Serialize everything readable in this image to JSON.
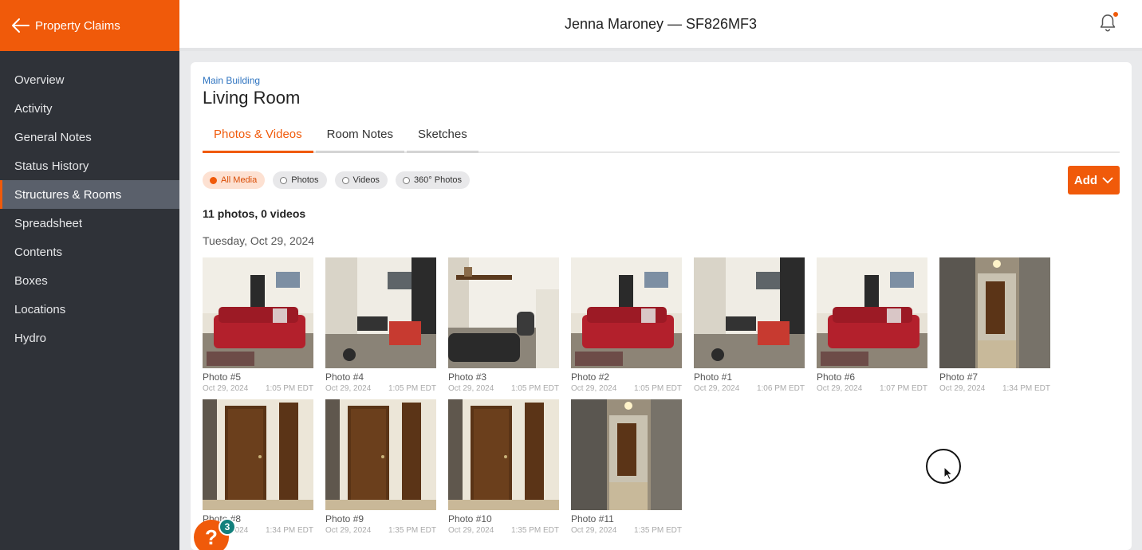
{
  "brand": {
    "label": "Property Claims",
    "icon": "back-arrow-icon"
  },
  "header": {
    "title": "Jenna Maroney — SF826MF3",
    "icon": "bell-icon"
  },
  "sidebar": {
    "items": [
      {
        "label": "Overview"
      },
      {
        "label": "Activity"
      },
      {
        "label": "General Notes"
      },
      {
        "label": "Status History"
      },
      {
        "label": "Structures & Rooms",
        "active": true
      },
      {
        "label": "Spreadsheet"
      },
      {
        "label": "Contents"
      },
      {
        "label": "Boxes"
      },
      {
        "label": "Locations"
      },
      {
        "label": "Hydro"
      }
    ]
  },
  "room": {
    "breadcrumb": "Main Building",
    "title": "Living Room"
  },
  "tabs": [
    {
      "label": "Photos & Videos",
      "active": true
    },
    {
      "label": "Room Notes"
    },
    {
      "label": "Sketches"
    }
  ],
  "filters": [
    {
      "label": "All Media",
      "active": true
    },
    {
      "label": "Photos"
    },
    {
      "label": "Videos"
    },
    {
      "label": "360° Photos"
    }
  ],
  "add_button": {
    "label": "Add"
  },
  "counts": "11 photos, 0 videos",
  "date_heading": "Tuesday, Oct 29, 2024",
  "photos": [
    {
      "name": "Photo #5",
      "date": "Oct 29, 2024",
      "time": "1:05 PM EDT",
      "scene": "sofa"
    },
    {
      "name": "Photo #4",
      "date": "Oct 29, 2024",
      "time": "1:05 PM EDT",
      "scene": "wall"
    },
    {
      "name": "Photo #3",
      "date": "Oct 29, 2024",
      "time": "1:05 PM EDT",
      "scene": "shelf"
    },
    {
      "name": "Photo #2",
      "date": "Oct 29, 2024",
      "time": "1:05 PM EDT",
      "scene": "sofa"
    },
    {
      "name": "Photo #1",
      "date": "Oct 29, 2024",
      "time": "1:06 PM EDT",
      "scene": "wall"
    },
    {
      "name": "Photo #6",
      "date": "Oct 29, 2024",
      "time": "1:07 PM EDT",
      "scene": "sofa"
    },
    {
      "name": "Photo #7",
      "date": "Oct 29, 2024",
      "time": "1:34 PM EDT",
      "scene": "hall"
    },
    {
      "name": "Photo #8",
      "date": "Oct 29, 2024",
      "time": "1:34 PM EDT",
      "scene": "door"
    },
    {
      "name": "Photo #9",
      "date": "Oct 29, 2024",
      "time": "1:35 PM EDT",
      "scene": "door"
    },
    {
      "name": "Photo #10",
      "date": "Oct 29, 2024",
      "time": "1:35 PM EDT",
      "scene": "door"
    },
    {
      "name": "Photo #11",
      "date": "Oct 29, 2024",
      "time": "1:35 PM EDT",
      "scene": "hall"
    }
  ],
  "help": {
    "label": "?",
    "count": "3"
  },
  "colors": {
    "accent": "#f05a0a",
    "sidebar": "#2f3238",
    "link": "#2f74c0",
    "badge": "#13807c"
  }
}
